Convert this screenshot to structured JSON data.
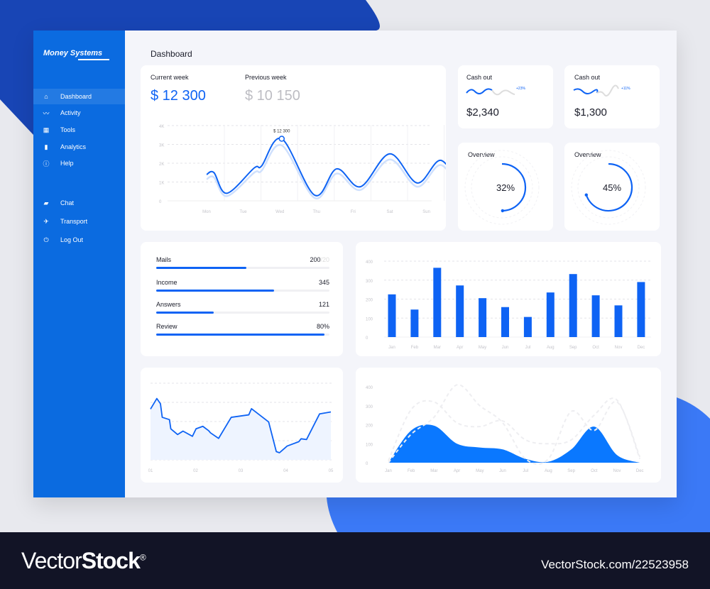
{
  "app": {
    "brand": "Money Systems",
    "page_title": "Dashboard",
    "accent": "#0e63f4",
    "sidebar_color": "#0b6be0"
  },
  "sidebar": {
    "items": [
      {
        "label": "Dashboard",
        "icon": "home-icon",
        "active": true
      },
      {
        "label": "Activity",
        "icon": "activity-icon"
      },
      {
        "label": "Tools",
        "icon": "grid-icon"
      },
      {
        "label": "Analytics",
        "icon": "bar-chart-icon"
      },
      {
        "label": "Help",
        "icon": "help-icon"
      },
      {
        "label": "Chat",
        "icon": "chat-icon"
      },
      {
        "label": "Transport",
        "icon": "plane-icon"
      },
      {
        "label": "Log Out",
        "icon": "power-icon"
      }
    ]
  },
  "weekly": {
    "current_label": "Current week",
    "current_value": "$ 12 300",
    "previous_label": "Previous week",
    "previous_value": "$ 10 150",
    "tooltip": "$ 12 300"
  },
  "cash": [
    {
      "label": "Cash out",
      "value": "$2,340",
      "change": "+23%"
    },
    {
      "label": "Cash out",
      "value": "$1,300",
      "change": "+11%"
    }
  ],
  "overview": [
    {
      "label": "Overview",
      "value": "32%",
      "fraction": 0.32
    },
    {
      "label": "Overview",
      "value": "45%",
      "fraction": 0.45
    }
  ],
  "progress": [
    {
      "label": "Mails",
      "value": "200",
      "suffix": "/20",
      "fill": 0.52
    },
    {
      "label": "Income",
      "value": "345",
      "fill": 0.68
    },
    {
      "label": "Answers",
      "value": "121",
      "fill": 0.33
    },
    {
      "label": "Review",
      "value": "80%",
      "fill": 0.97
    }
  ],
  "chart_data": [
    {
      "type": "line",
      "yticks": [
        "0",
        "1K",
        "2K",
        "3K",
        "4K"
      ],
      "ylim": [
        0,
        4000
      ],
      "categories": [
        "Mon",
        "Tue",
        "Wed",
        "Thu",
        "Fri",
        "Sat",
        "Sun",
        "Mon"
      ],
      "grid": true,
      "series": [
        {
          "points": [
            [
              0,
              1400
            ],
            [
              0.2,
              1500
            ],
            [
              0.55,
              400
            ],
            [
              1.3,
              1750
            ],
            [
              1.5,
              1850
            ],
            [
              2.05,
              3300
            ],
            [
              2.95,
              300
            ],
            [
              3.55,
              1700
            ],
            [
              4.2,
              750
            ],
            [
              5,
              2500
            ],
            [
              5.75,
              950
            ],
            [
              6.4,
              2150
            ],
            [
              7,
              400
            ]
          ]
        },
        {
          "points": [
            [
              0,
              1150
            ],
            [
              0.2,
              1250
            ],
            [
              0.55,
              250
            ],
            [
              1.3,
              1500
            ],
            [
              1.5,
              1600
            ],
            [
              2.05,
              2950
            ],
            [
              2.95,
              150
            ],
            [
              3.55,
              1450
            ],
            [
              4.2,
              580
            ],
            [
              5,
              2200
            ],
            [
              5.75,
              750
            ],
            [
              6.4,
              1900
            ],
            [
              7,
              250
            ]
          ]
        }
      ],
      "annotation": {
        "x": 2.05,
        "y": 3300,
        "label": "$ 12 300"
      }
    },
    {
      "type": "bar",
      "categories": [
        "Jan",
        "Feb",
        "Mar",
        "Apr",
        "May",
        "Jun",
        "Jul",
        "Aug",
        "Sep",
        "Oct",
        "Nov",
        "Dec"
      ],
      "values": [
        225,
        145,
        365,
        272,
        205,
        158,
        106,
        235,
        332,
        220,
        167,
        290
      ],
      "yticks": [
        "0",
        "100",
        "200",
        "300",
        "400"
      ],
      "ylim": [
        0,
        400
      ],
      "grid": true
    },
    {
      "type": "line",
      "categories": [
        "01",
        "02",
        "03",
        "04",
        "05"
      ],
      "ylim": [
        0,
        4
      ],
      "grid": true,
      "fill": true,
      "points": [
        [
          1,
          2.65
        ],
        [
          1.14,
          3.2
        ],
        [
          1.22,
          2.93
        ],
        [
          1.26,
          2.22
        ],
        [
          1.42,
          2.1
        ],
        [
          1.45,
          1.62
        ],
        [
          1.6,
          1.32
        ],
        [
          1.72,
          1.5
        ],
        [
          1.93,
          1.23
        ],
        [
          2.01,
          1.62
        ],
        [
          2.16,
          1.75
        ],
        [
          2.29,
          1.52
        ],
        [
          2.33,
          1.41
        ],
        [
          2.51,
          1.12
        ],
        [
          2.79,
          2.22
        ],
        [
          3.18,
          2.35
        ],
        [
          3.24,
          2.67
        ],
        [
          3.62,
          1.98
        ],
        [
          3.79,
          0.43
        ],
        [
          3.86,
          0.37
        ],
        [
          4.03,
          0.72
        ],
        [
          4.29,
          0.95
        ],
        [
          4.34,
          1.1
        ],
        [
          4.46,
          1.06
        ],
        [
          4.75,
          2.4
        ],
        [
          5,
          2.5
        ]
      ]
    },
    {
      "type": "area",
      "categories": [
        "Jan",
        "Feb",
        "Mar",
        "Apr",
        "May",
        "Jun",
        "Jul",
        "Aug",
        "Sep",
        "Oct",
        "Nov",
        "Dec"
      ],
      "yticks": [
        "0",
        "100",
        "200",
        "300",
        "400"
      ],
      "ylim": [
        0,
        400
      ],
      "series": [
        {
          "values": [
            0,
            170,
            195,
            100,
            80,
            70,
            20,
            5,
            70,
            190,
            40,
            0
          ],
          "filled": true
        },
        {
          "values": [
            10,
            280,
            320,
            210,
            190,
            220,
            120,
            100,
            120,
            250,
            330,
            20
          ],
          "dashed": true
        },
        {
          "values": [
            0,
            150,
            240,
            410,
            300,
            210,
            20,
            20,
            270,
            170,
            320,
            30
          ],
          "dashed": true
        }
      ]
    }
  ],
  "footer": {
    "brand_light": "Vector",
    "brand_bold": "Stock",
    "reg": "®",
    "url": "VectorStock.com/22523958"
  }
}
